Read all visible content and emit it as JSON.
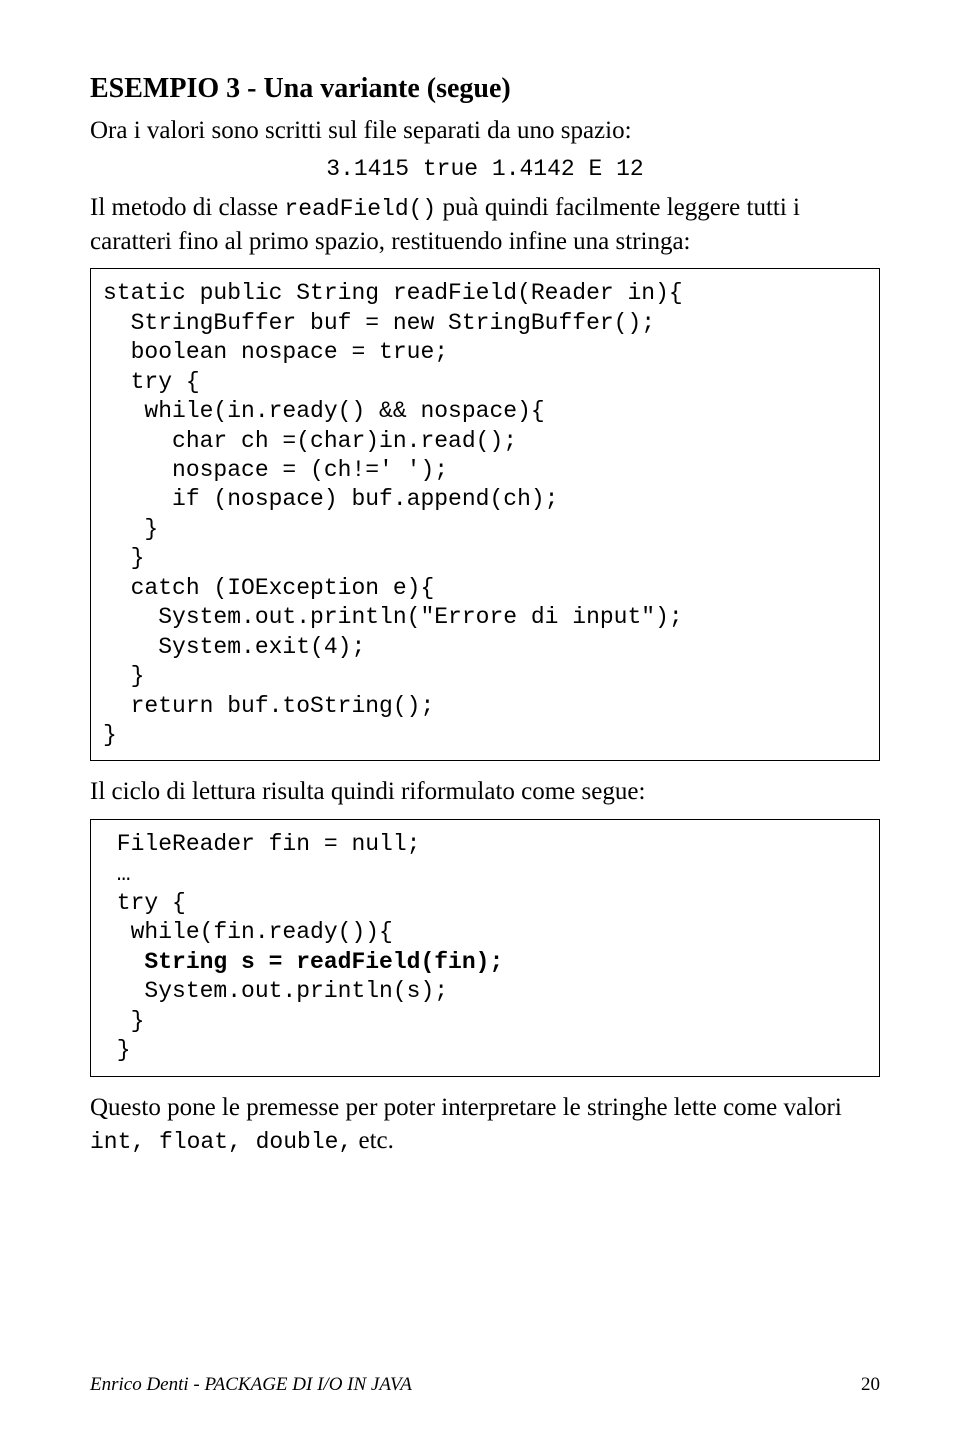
{
  "heading": "ESEMPIO 3 - Una variante (segue)",
  "p1": "Ora i valori sono scritti sul file separati da uno spazio:",
  "sample_line": "3.1415 true 1.4142 E 12",
  "p2_a": "Il metodo di classe ",
  "p2_code": "readField()",
  "p2_b": " puà quindi facilmente leggere tutti i caratteri fino al primo spazio, restituendo infine una stringa:",
  "code1": "static public String readField(Reader in){\n  StringBuffer buf = new StringBuffer();\n  boolean nospace = true;\n  try {\n   while(in.ready() && nospace){\n     char ch =(char)in.read();\n     nospace = (ch!=' ');\n     if (nospace) buf.append(ch);\n   }\n  }\n  catch (IOException e){\n    System.out.println(\"Errore di input\");\n    System.exit(4);\n  }\n  return buf.toString();\n}",
  "p3": "Il ciclo di lettura risulta quindi riformulato come segue:",
  "code2_pre": " FileReader fin = null;\n …\n try {\n  while(fin.ready()){\n",
  "code2_bold": "   String s = readField(fin);\n",
  "code2_post": "   System.out.println(s);\n  }\n }",
  "p4_a": "Questo pone le premesse per poter interpretare le stringhe lette come valori ",
  "p4_code": "int, float, double,",
  "p4_b": " etc.",
  "footer_left": "Enrico Denti - PACKAGE DI I/O IN JAVA",
  "footer_page": "20"
}
